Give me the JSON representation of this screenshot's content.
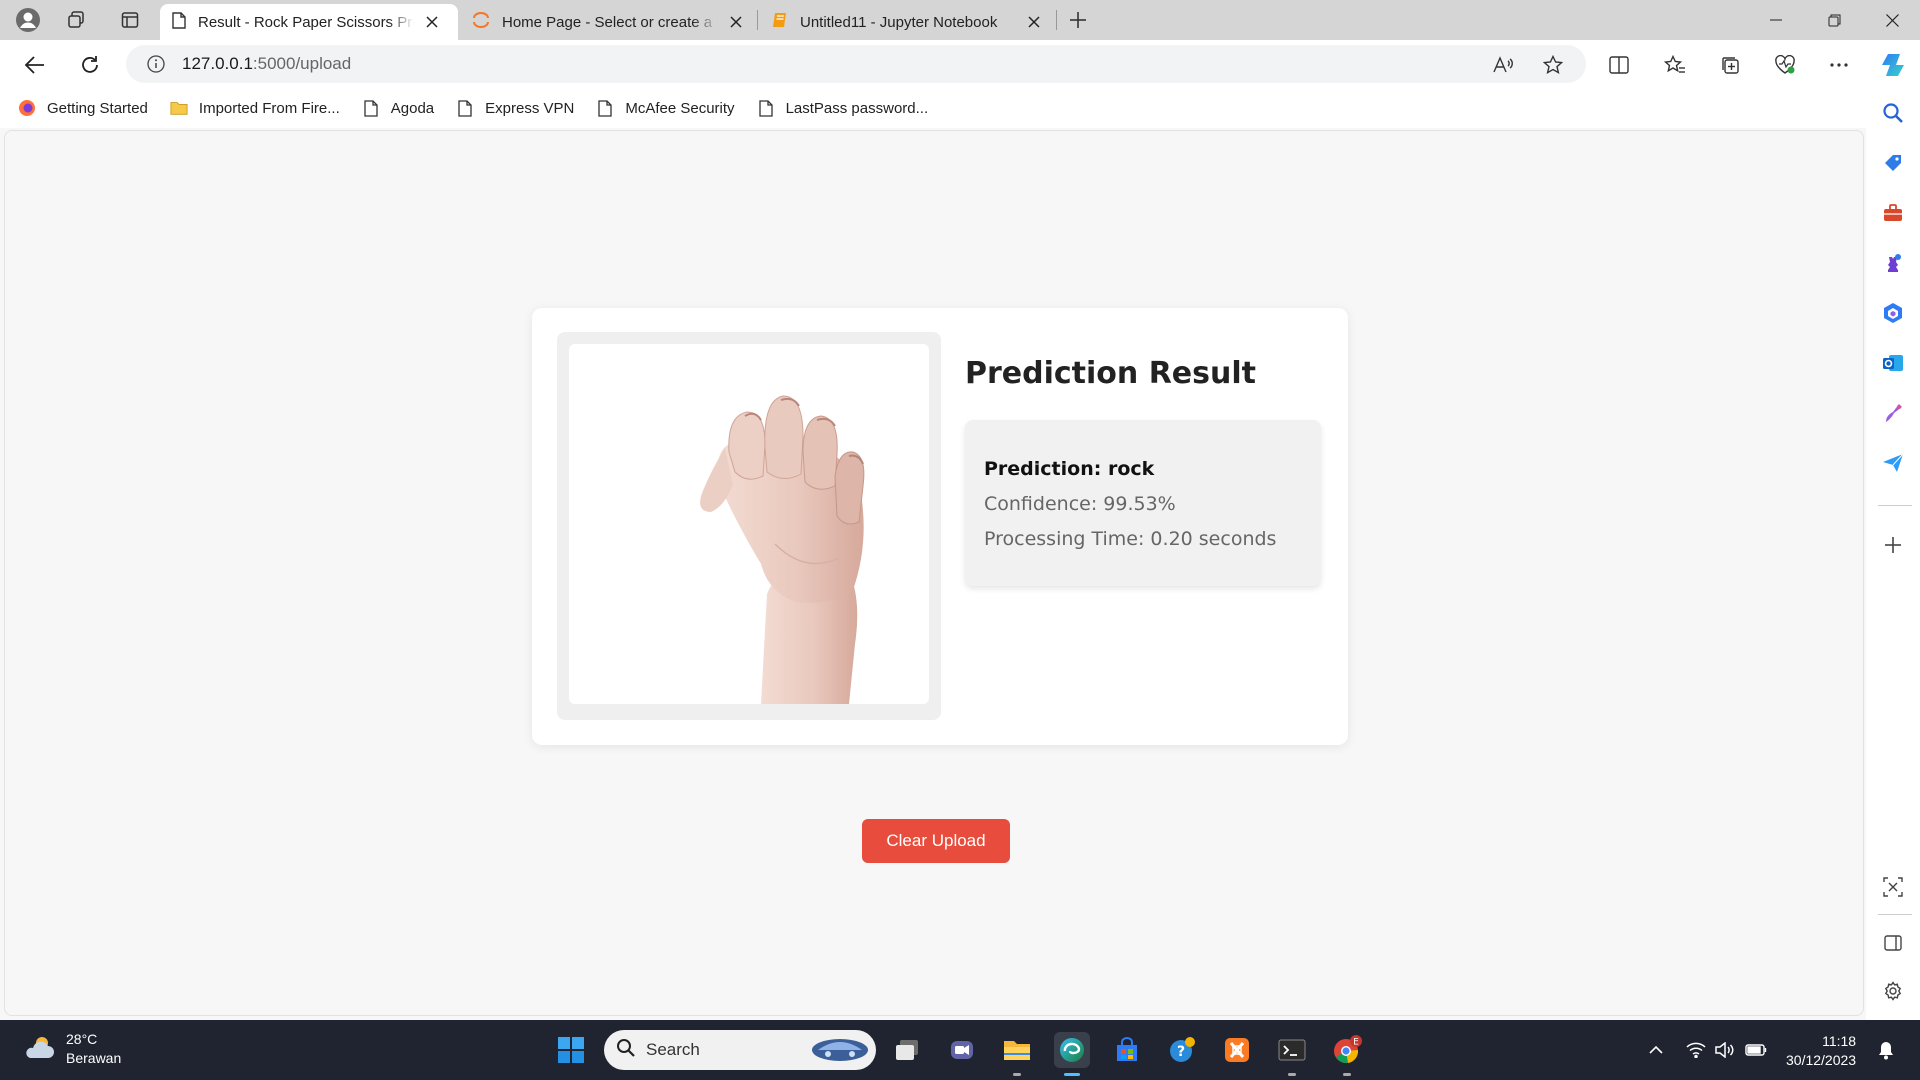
{
  "browser": {
    "tabs": [
      {
        "title": "Result - Rock Paper Scissors Prediction",
        "active": true,
        "icon": "page-icon"
      },
      {
        "title": "Home Page - Select or create a notebook",
        "active": false,
        "icon": "jupyter-icon"
      },
      {
        "title": "Untitled11 - Jupyter Notebook",
        "active": false,
        "icon": "notebook-icon"
      }
    ],
    "url_host": "127.0.0.1",
    "url_rest": ":5000/upload",
    "favorites": [
      {
        "label": "Getting Started",
        "icon": "firefox-icon"
      },
      {
        "label": "Imported From Fire...",
        "icon": "folder-icon"
      },
      {
        "label": "Agoda",
        "icon": "page-icon"
      },
      {
        "label": "Express VPN",
        "icon": "page-icon"
      },
      {
        "label": "McAfee Security",
        "icon": "page-icon"
      },
      {
        "label": "LastPass password...",
        "icon": "page-icon"
      }
    ]
  },
  "page": {
    "title": "Prediction Result",
    "prediction": "Prediction: rock",
    "confidence": "Confidence: 99.53%",
    "processing_time": "Processing Time: 0.20 seconds",
    "clear_button": "Clear Upload",
    "accent_color": "#e74c3c"
  },
  "taskbar": {
    "weather_temp": "28°C",
    "weather_desc": "Berawan",
    "search_placeholder": "Search",
    "time": "11:18",
    "date": "30/12/2023",
    "chrome_badge": "E"
  }
}
